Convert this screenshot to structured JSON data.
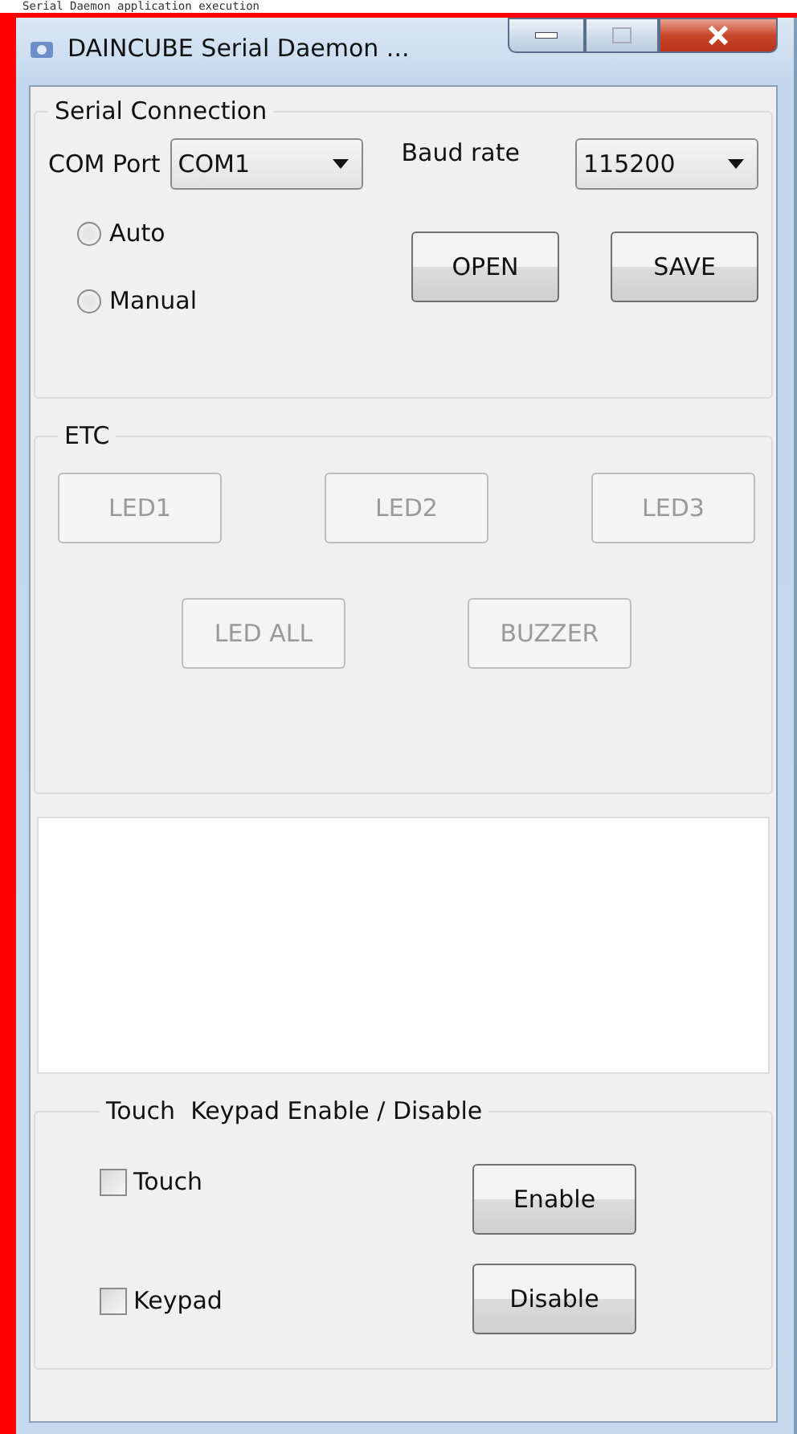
{
  "background_text": "Serial Daemon application execution",
  "window": {
    "title": "DAINCUBE Serial Daemon ..."
  },
  "serial_connection": {
    "title": "Serial Connection",
    "com_port": {
      "label": "COM Port",
      "value": "COM1"
    },
    "baud_rate": {
      "label": "Baud rate",
      "value": "115200"
    },
    "modes": [
      {
        "label": "Auto",
        "selected": false
      },
      {
        "label": "Manual",
        "selected": false
      }
    ],
    "buttons": [
      {
        "label": "OPEN",
        "disabled": false
      },
      {
        "label": "SAVE",
        "disabled": false
      }
    ]
  },
  "etc": {
    "title": "ETC",
    "rows": [
      [
        {
          "label": "LED1",
          "disabled": true
        },
        {
          "label": "LED2",
          "disabled": true
        },
        {
          "label": "LED3",
          "disabled": true
        }
      ],
      [
        {
          "label": "LED ALL",
          "disabled": true
        },
        {
          "label": "BUZZER",
          "disabled": true
        }
      ]
    ]
  },
  "touch_keypad": {
    "title": "Touch  Keypad Enable / Disable",
    "options": [
      {
        "label": "Touch",
        "checked": false
      },
      {
        "label": "Keypad",
        "checked": false
      }
    ],
    "buttons": [
      {
        "label": "Enable",
        "disabled": false
      },
      {
        "label": "Disable",
        "disabled": false
      }
    ]
  }
}
